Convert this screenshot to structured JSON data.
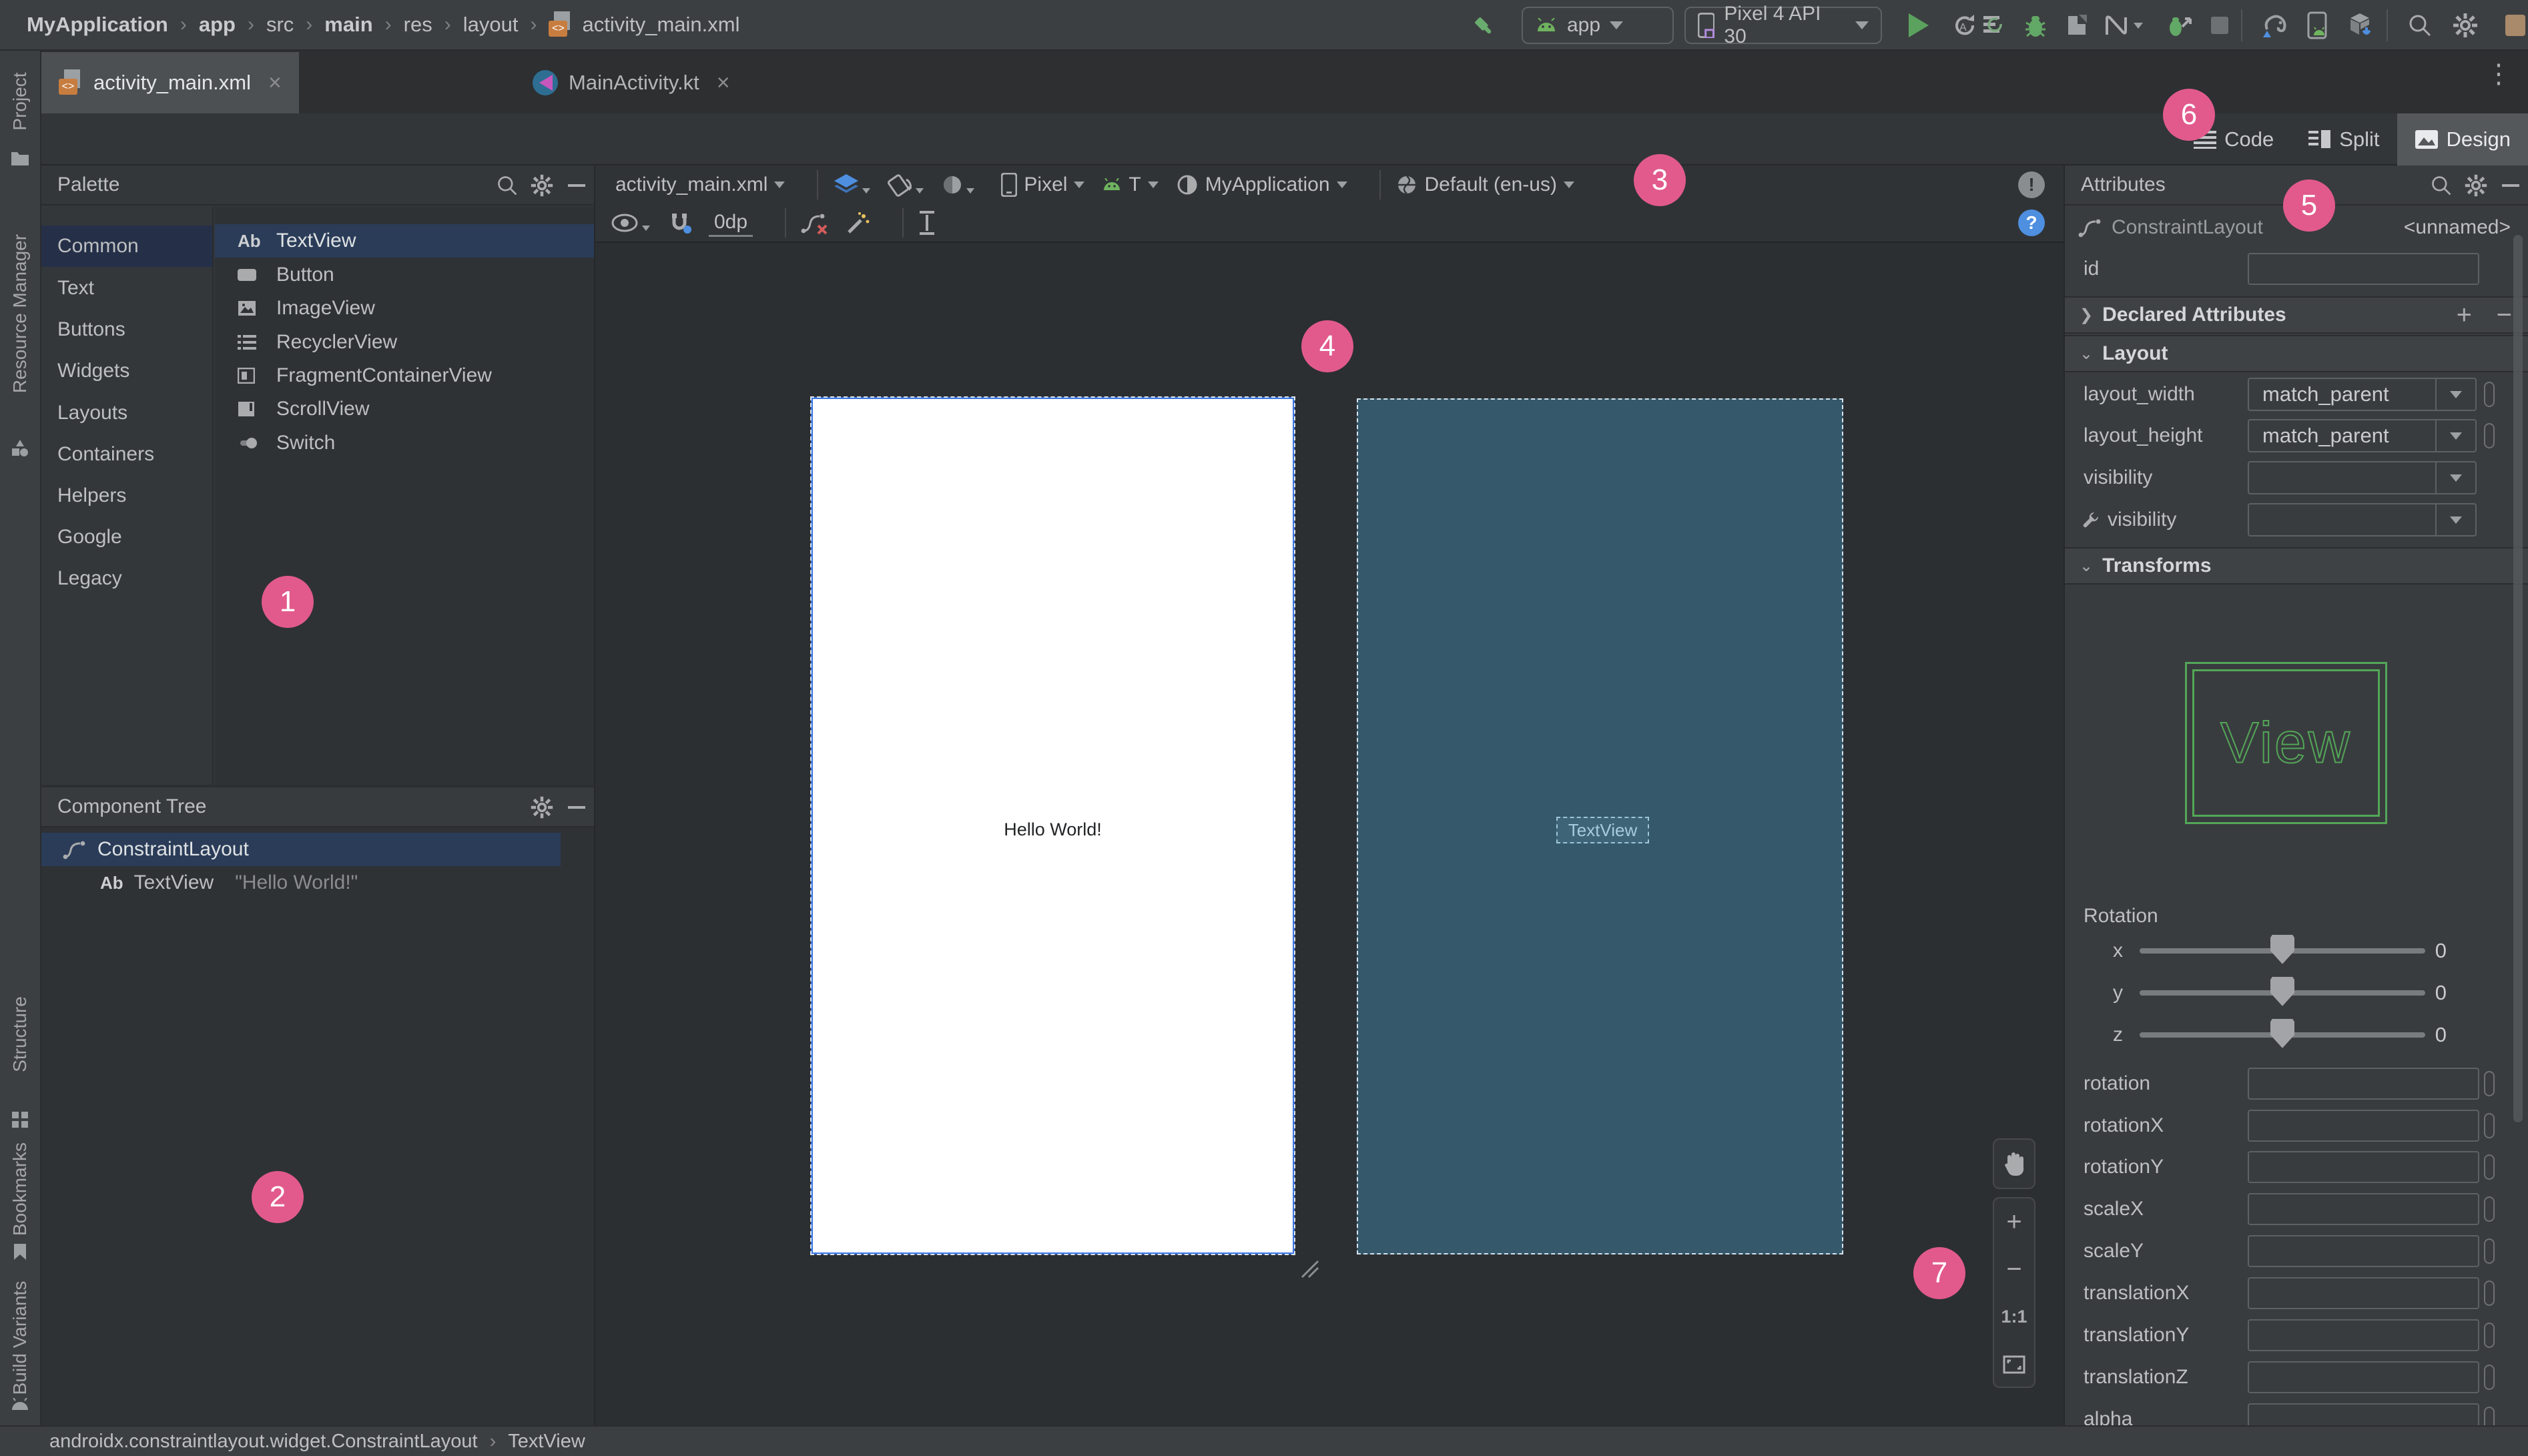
{
  "breadcrumb": {
    "separator": "›",
    "items": [
      {
        "label": "MyApplication"
      },
      {
        "label": "app"
      },
      {
        "label": "src"
      },
      {
        "label": "main"
      },
      {
        "label": "res"
      },
      {
        "label": "layout"
      },
      {
        "label": "activity_main.xml"
      }
    ]
  },
  "run_toolbar": {
    "config": "app",
    "device": "Pixel 4 API 30"
  },
  "tabs": {
    "items": [
      {
        "label": "activity_main.xml"
      },
      {
        "label": "MainActivity.kt"
      }
    ],
    "close": "×"
  },
  "mode_switcher": {
    "code": "Code",
    "split": "Split",
    "design": "Design",
    "selected": "Design"
  },
  "tool_strips": {
    "left": [
      "Project",
      "Resource Manager",
      "Structure",
      "Bookmarks",
      "Build Variants"
    ]
  },
  "palette": {
    "title": "Palette",
    "categories": [
      "Common",
      "Text",
      "Buttons",
      "Widgets",
      "Layouts",
      "Containers",
      "Helpers",
      "Google",
      "Legacy"
    ],
    "selected_category": "Common",
    "components": [
      "TextView",
      "Button",
      "ImageView",
      "RecyclerView",
      "FragmentContainerView",
      "ScrollView",
      "Switch"
    ],
    "selected_component": "TextView",
    "textview_icon": "Ab"
  },
  "component_tree": {
    "title": "Component Tree",
    "root": "ConstraintLayout",
    "child": "TextView",
    "child_icon": "Ab",
    "child_text": "\"Hello World!\""
  },
  "design_toolbar": {
    "file": "activity_main.xml",
    "device": "Pixel",
    "api_level": "T",
    "theme": "MyApplication",
    "locale": "Default (en-us)",
    "default_margin": "0dp"
  },
  "canvas": {
    "design_text": "Hello World!",
    "blueprint_component": "TextView"
  },
  "zoom_controls": {
    "zoom_in": "+",
    "zoom_out": "−",
    "actual_size": "1:1"
  },
  "attributes": {
    "title": "Attributes",
    "component": "ConstraintLayout",
    "instance": "<unnamed>",
    "id_label": "id",
    "id_value": "",
    "declared_section": "Declared Attributes",
    "layout_section": "Layout",
    "transforms_section": "Transforms",
    "layout_rows": [
      {
        "label": "layout_width",
        "value": "match_parent"
      },
      {
        "label": "layout_height",
        "value": "match_parent"
      },
      {
        "label": "visibility",
        "value": ""
      },
      {
        "label": "visibility",
        "value": ""
      }
    ],
    "view_preview_label": "View",
    "rotation_label": "Rotation",
    "sliders": [
      {
        "axis": "x",
        "value": "0"
      },
      {
        "axis": "y",
        "value": "0"
      },
      {
        "axis": "z",
        "value": "0"
      }
    ],
    "transform_fields": [
      "rotation",
      "rotationX",
      "rotationY",
      "scaleX",
      "scaleY",
      "translationX",
      "translationY",
      "translationZ",
      "alpha"
    ]
  },
  "status_bar": {
    "path": "androidx.constraintlayout.widget.ConstraintLayout",
    "separator": "›",
    "selection": "TextView"
  },
  "annotations": {
    "labels": [
      "1",
      "2",
      "3",
      "4",
      "5",
      "6",
      "7"
    ]
  },
  "colors": {
    "accent_pink": "#E25A8C",
    "selection_blue": "#2A3C58",
    "blueprint_teal": "#35596B",
    "preview_green": "#53A657"
  }
}
